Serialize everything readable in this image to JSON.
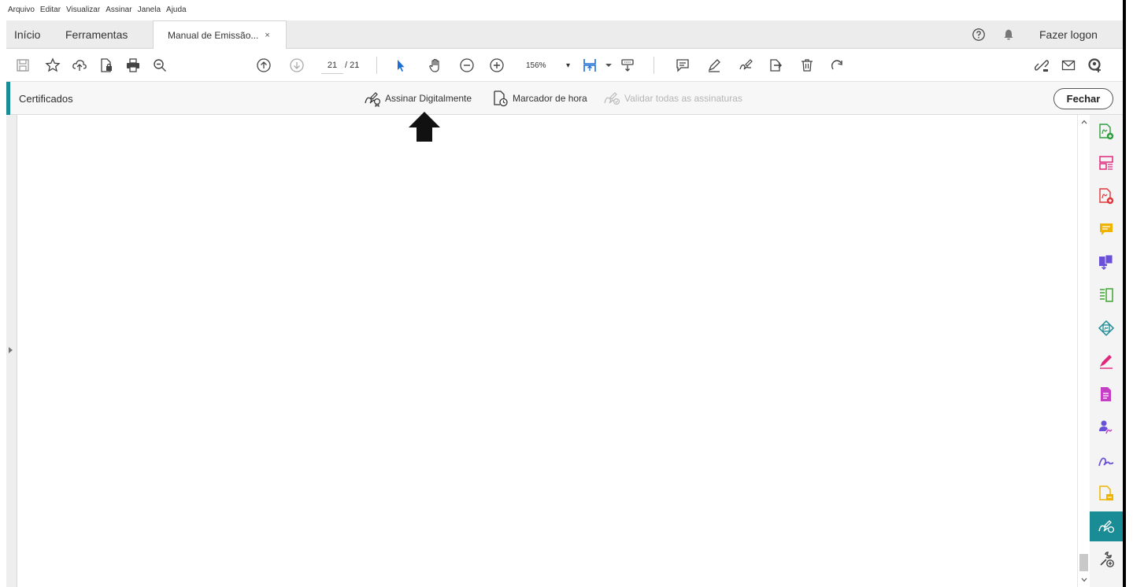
{
  "menu": [
    "Arquivo",
    "Editar",
    "Visualizar",
    "Assinar",
    "Janela",
    "Ajuda"
  ],
  "tabs": {
    "home": "Início",
    "tools": "Ferramentas",
    "document": "Manual de Emissão...",
    "close_glyph": "×"
  },
  "header": {
    "login": "Fazer logon"
  },
  "toolbar": {
    "page_current": "21",
    "page_total": "/ 21",
    "zoom": "156%",
    "zoom_caret": "▾"
  },
  "certificates": {
    "title": "Certificados",
    "sign_digitally": "Assinar Digitalmente",
    "timestamp": "Marcador de hora",
    "validate_all": "Validar todas as assinaturas",
    "close": "Fechar"
  },
  "colors": {
    "accent": "#1a8c96",
    "green": "#2e9e3e",
    "pink": "#e0267a",
    "red": "#e0373a",
    "yellow": "#f0b400",
    "purple": "#6a4fd8",
    "magenta": "#c43fc4",
    "lime": "#3fa535"
  },
  "right_panel_tools": [
    "create-pdf-icon",
    "organize-pages-icon",
    "export-pdf-icon",
    "comment-icon",
    "export-pages-icon",
    "edit-layout-icon",
    "export-pdf-teal-icon",
    "fill-sign-icon",
    "send-pdf-icon",
    "request-signature-icon",
    "sign-icon",
    "stamp-icon",
    "certificates-icon",
    "more-tools-icon"
  ]
}
